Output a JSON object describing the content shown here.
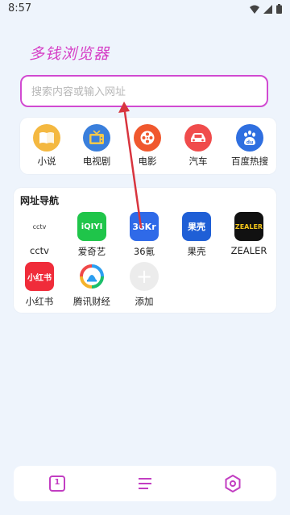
{
  "status_bar": {
    "time": "8:57"
  },
  "app": {
    "title": "多钱浏览器"
  },
  "search": {
    "placeholder": "搜索内容或输入网址",
    "value": ""
  },
  "quick_links": [
    {
      "label": "小说",
      "icon": "book-icon",
      "color": "#f4b840"
    },
    {
      "label": "电视剧",
      "icon": "tv-icon",
      "color": "#3a7fdc"
    },
    {
      "label": "电影",
      "icon": "film-reel-icon",
      "color": "#f0582e"
    },
    {
      "label": "汽车",
      "icon": "car-icon",
      "color": "#f04c4c"
    },
    {
      "label": "百度热搜",
      "icon": "baidu-paw-icon",
      "color": "#2f6fe0"
    }
  ],
  "site_nav": {
    "title": "网址导航",
    "sites": [
      {
        "label": "cctv",
        "icon_text": "cctv"
      },
      {
        "label": "爱奇艺",
        "icon_text": "iQIYI"
      },
      {
        "label": "36氪",
        "icon_text": "36Kr"
      },
      {
        "label": "果壳",
        "icon_text": "果壳"
      },
      {
        "label": "ZEALER",
        "icon_text": "ZEALER"
      },
      {
        "label": "小红书",
        "icon_text": "小红书"
      },
      {
        "label": "腾讯财经",
        "icon_text": ""
      },
      {
        "label": "添加",
        "icon_text": "+"
      }
    ]
  },
  "bottom_bar": {
    "tab_count": "1"
  },
  "colors": {
    "accent": "#d63fc6",
    "background": "#eef4fc"
  }
}
